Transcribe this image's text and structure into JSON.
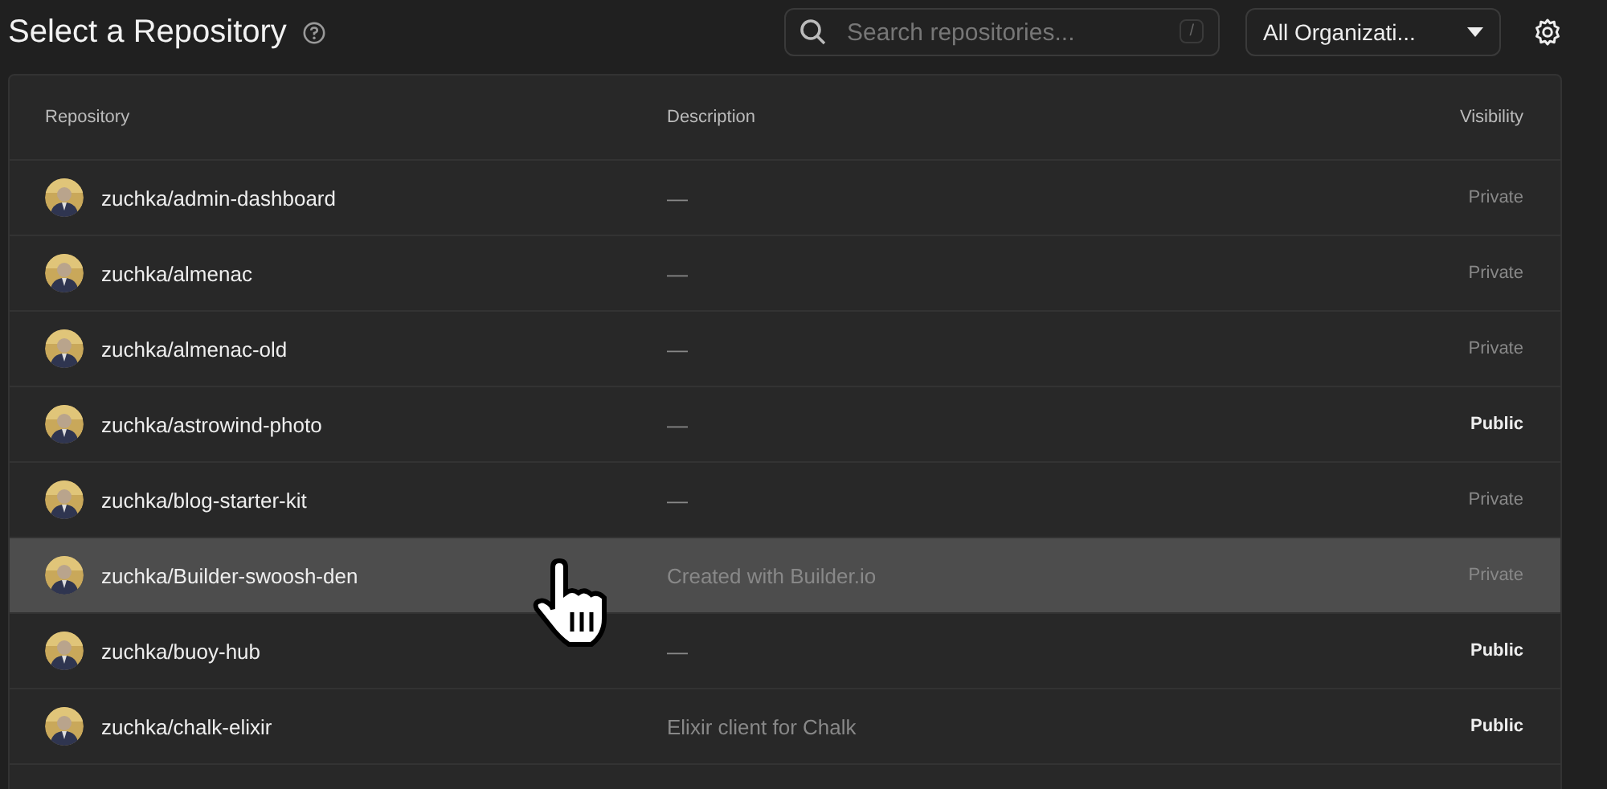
{
  "header": {
    "title": "Select a Repository",
    "search": {
      "placeholder": "Search repositories...",
      "shortcut": "/"
    },
    "organization_dropdown": {
      "value": "All Organizati..."
    }
  },
  "table": {
    "columns": [
      "Repository",
      "Description",
      "Visibility"
    ],
    "rows": [
      {
        "repository": "zuchka/admin-dashboard",
        "description": "—",
        "visibility": "Private",
        "public": false,
        "highlighted": false
      },
      {
        "repository": "zuchka/almenac",
        "description": "—",
        "visibility": "Private",
        "public": false,
        "highlighted": false
      },
      {
        "repository": "zuchka/almenac-old",
        "description": "—",
        "visibility": "Private",
        "public": false,
        "highlighted": false
      },
      {
        "repository": "zuchka/astrowind-photo",
        "description": "—",
        "visibility": "Public",
        "public": true,
        "highlighted": false
      },
      {
        "repository": "zuchka/blog-starter-kit",
        "description": "—",
        "visibility": "Private",
        "public": false,
        "highlighted": false
      },
      {
        "repository": "zuchka/Builder-swoosh-den",
        "description": "Created with Builder.io",
        "visibility": "Private",
        "public": false,
        "highlighted": true
      },
      {
        "repository": "zuchka/buoy-hub",
        "description": "—",
        "visibility": "Public",
        "public": true,
        "highlighted": false
      },
      {
        "repository": "zuchka/chalk-elixir",
        "description": "Elixir client for Chalk",
        "visibility": "Public",
        "public": true,
        "highlighted": false
      }
    ]
  }
}
